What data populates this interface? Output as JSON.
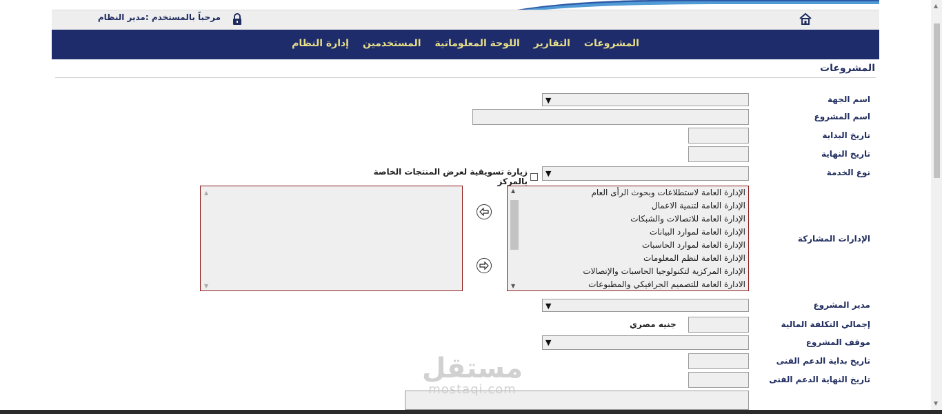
{
  "header": {
    "welcome_text": "مرحباً بالمستخدم :مدير النظام",
    "home_icon": "home-icon",
    "lock_icon": "lock-icon"
  },
  "nav": {
    "items": [
      "المشروعات",
      "التقارير",
      "اللوحة المعلوماتية",
      "المستخدمين",
      "إدارة النظام"
    ]
  },
  "section": {
    "title": "المشروعات"
  },
  "form": {
    "labels": {
      "entity": "اسم الجهة",
      "project_name": "اسم المشروع",
      "start_date": "تاريخ البداية",
      "end_date": "تاريخ النهاية",
      "service_type": "نوع الخدمة",
      "departments": "الإدارات المشاركة",
      "manager": "مدير المشروع",
      "total_cost": "إجمالي التكلفة المالية",
      "status": "موقف المشروع",
      "support_start": "تاريخ بداية الدعم الفنى",
      "support_end": "تاريخ النهاية الدعم الفنى"
    },
    "checkbox_label": "زيارة تسويقية لعرض المنتجات الخاصة بالمركز",
    "currency": "جنيه مصري",
    "departments_available": [
      "الإدارة العامة لاستطلاعات وبحوث الرأى العام",
      "الإدارة العامة لتنمية الاعمال",
      "الإدارة العامة للاتصالات والشبكات",
      "الإدارة العامة لموارد البيانات",
      "الإدارة العامة لموارد الحاسبات",
      "الإدارة العامة لنظم المعلومات",
      "الإدارة المركزية لتكنولوجيا الحاسبات والإتصالات",
      "الادارة العامة للتصميم الجرافيكي والمطبوعات"
    ]
  },
  "watermark": {
    "main": "مستقل",
    "sub": "mostaqi.com"
  },
  "colors": {
    "nav_bg": "#1f2c6b",
    "nav_text": "#e8e089",
    "label": "#1f2c5e",
    "list_border": "#8b1a1a"
  }
}
